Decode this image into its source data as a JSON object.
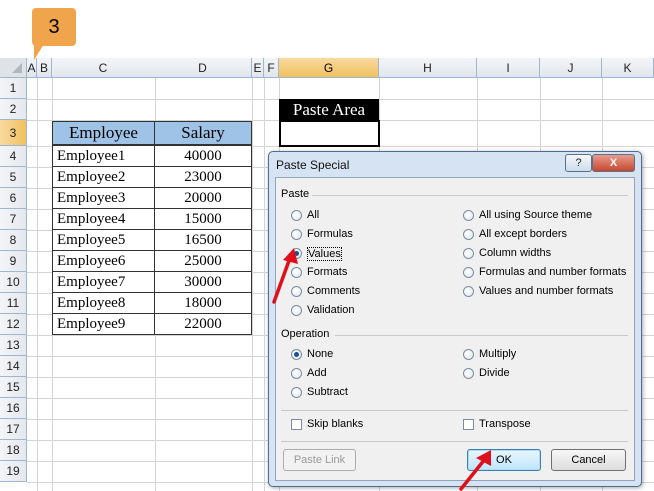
{
  "step_badge": "3",
  "columns": [
    "A",
    "B",
    "C",
    "D",
    "E",
    "F",
    "G",
    "H",
    "I",
    "J",
    "K"
  ],
  "rows": [
    "1",
    "2",
    "3",
    "4",
    "5",
    "6",
    "7",
    "8",
    "9",
    "10",
    "11",
    "12",
    "13",
    "14",
    "15",
    "16",
    "17",
    "18",
    "19"
  ],
  "paste_area_label": "Paste Area",
  "table": {
    "headers": [
      "Employee",
      "Salary"
    ],
    "rows": [
      [
        "Employee1",
        "40000"
      ],
      [
        "Employee2",
        "23000"
      ],
      [
        "Employee3",
        "20000"
      ],
      [
        "Employee4",
        "15000"
      ],
      [
        "Employee5",
        "16500"
      ],
      [
        "Employee6",
        "25000"
      ],
      [
        "Employee7",
        "30000"
      ],
      [
        "Employee8",
        "18000"
      ],
      [
        "Employee9",
        "22000"
      ]
    ]
  },
  "dialog": {
    "title": "Paste Special",
    "help_label": "?",
    "close_label": "X",
    "paste_group": "Paste",
    "paste_options_left": [
      "All",
      "Formulas",
      "Values",
      "Formats",
      "Comments",
      "Validation"
    ],
    "paste_options_right": [
      "All using Source theme",
      "All except borders",
      "Column widths",
      "Formulas and number formats",
      "Values and number formats"
    ],
    "paste_selected": "Values",
    "operation_group": "Operation",
    "operation_options_left": [
      "None",
      "Add",
      "Subtract"
    ],
    "operation_options_right": [
      "Multiply",
      "Divide"
    ],
    "operation_selected": "None",
    "skip_blanks_label": "Skip blanks",
    "transpose_label": "Transpose",
    "skip_blanks_checked": false,
    "transpose_checked": false,
    "paste_link_label": "Paste Link",
    "ok_label": "OK",
    "cancel_label": "Cancel"
  },
  "colors": {
    "selected_header": "#f1c15f",
    "table_header_fill": "#9fc3e6",
    "badge": "#f0a54d",
    "arrow": "#e0101a"
  }
}
